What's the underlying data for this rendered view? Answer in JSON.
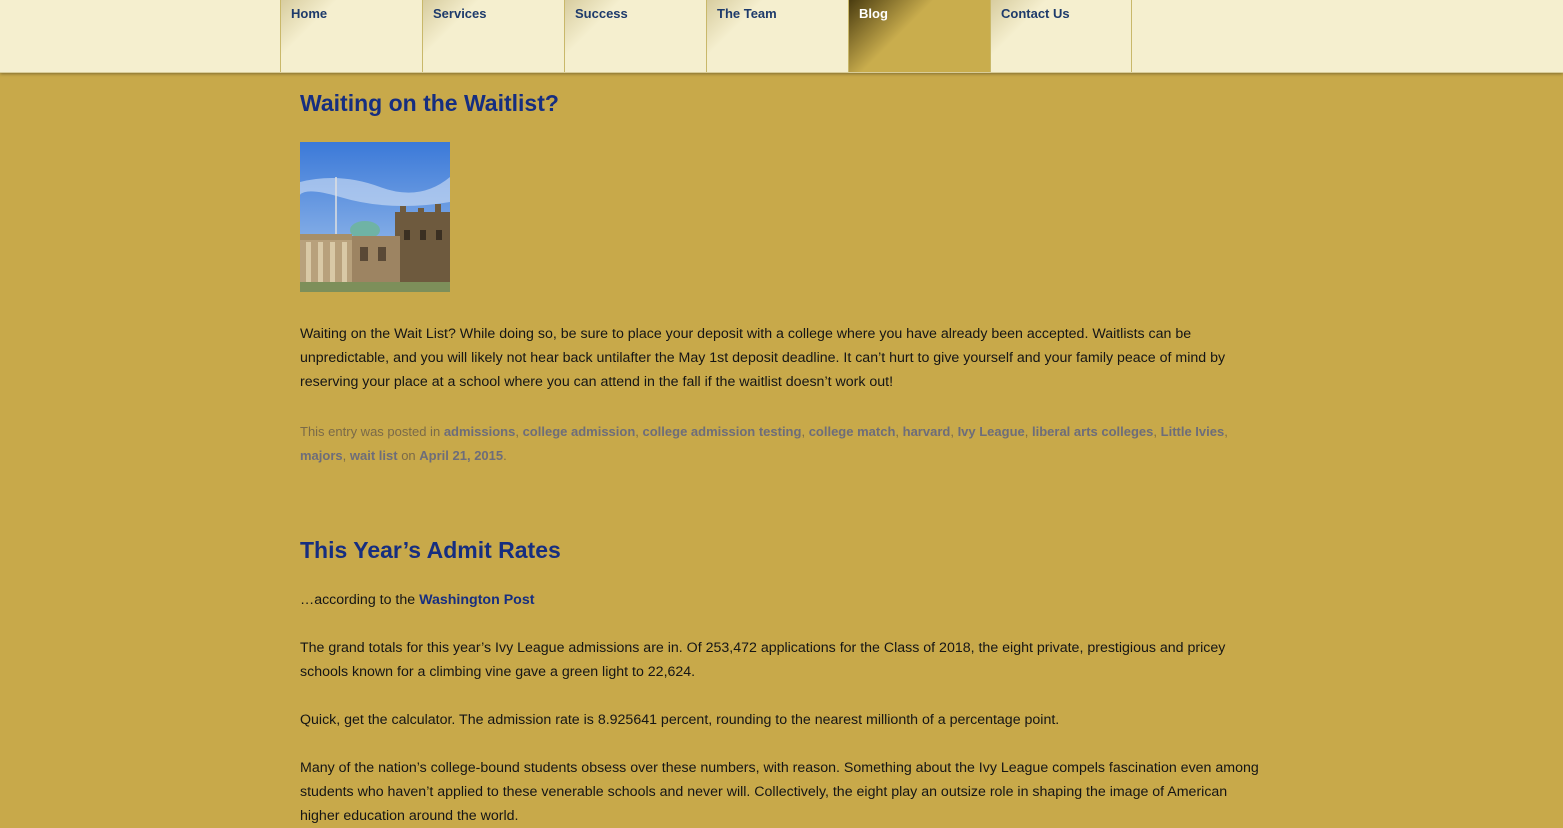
{
  "nav": {
    "items": [
      {
        "label": "Home"
      },
      {
        "label": "Services"
      },
      {
        "label": "Success"
      },
      {
        "label": "The Team"
      },
      {
        "label": "Blog",
        "active": true
      },
      {
        "label": "Contact Us"
      }
    ]
  },
  "posts": [
    {
      "title": "Waiting on the Waitlist?",
      "image_alt": "campus-building-photo",
      "body": "Waiting on the Wait List? While doing so, be sure to place your deposit with a college where you have already been accepted. Waitlists can be unpredictable, and you will likely not hear back untilafter the May 1st deposit deadline. It can’t hurt to give yourself and your family peace of mind by reserving your place at a school where you can attend in the fall if the waitlist doesn’t work out!",
      "meta": {
        "prefix": "This entry was posted in",
        "tags": [
          "admissions",
          "college admission",
          "college admission testing",
          "college match",
          "harvard",
          "Ivy League",
          "liberal arts colleges",
          "Little Ivies",
          "majors",
          "wait list"
        ],
        "on": "on",
        "date": "April 21, 2015",
        "end": "."
      }
    },
    {
      "title": "This Year’s Admit Rates",
      "intro_prefix": "…according to the",
      "intro_link": "Washington Post",
      "paragraphs": [
        "The grand totals for this year’s Ivy League admissions are in. Of 253,472 applications for the Class of 2018, the eight private, prestigious and pricey schools known for a climbing vine gave a green light to 22,624.",
        "Quick, get the calculator. The admission rate is 8.925641 percent, rounding to the nearest millionth of a percentage point.",
        "Many of the nation’s college-bound students obsess over these numbers, with reason. Something about the Ivy League compels fascination even among students who haven’t applied to these venerable schools and never will. Collectively, the eight play an outsize role in shaping the image of American higher education around the world."
      ]
    }
  ],
  "colors": {
    "background": "#c8a94a",
    "nav_bg": "#f5efcf",
    "title": "#162e80",
    "nav_text": "#1d3a6b"
  }
}
